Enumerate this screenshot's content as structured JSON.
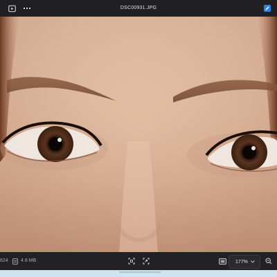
{
  "window": {
    "title": "DSC00931.JPG"
  },
  "titlebar": {
    "left_icons": [
      "slideshow-icon",
      "more-icon"
    ],
    "right_icons": [
      "edit-icon"
    ]
  },
  "photo": {
    "subject": "close-up of face showing eyes and eyebrows"
  },
  "bottombar": {
    "dimensions_partial": "624",
    "file_size": "4.8 MB",
    "zoom_level": "177%",
    "center_icons": [
      "fit-screen-icon",
      "actual-size-icon"
    ],
    "right_icons": [
      "fill-window-icon",
      "zoom-out-icon"
    ]
  },
  "colors": {
    "titlebar_bg": "#202022",
    "bottombar_bg": "#222224",
    "accent": "#1e90ff",
    "strip": "#cfe4ee"
  }
}
